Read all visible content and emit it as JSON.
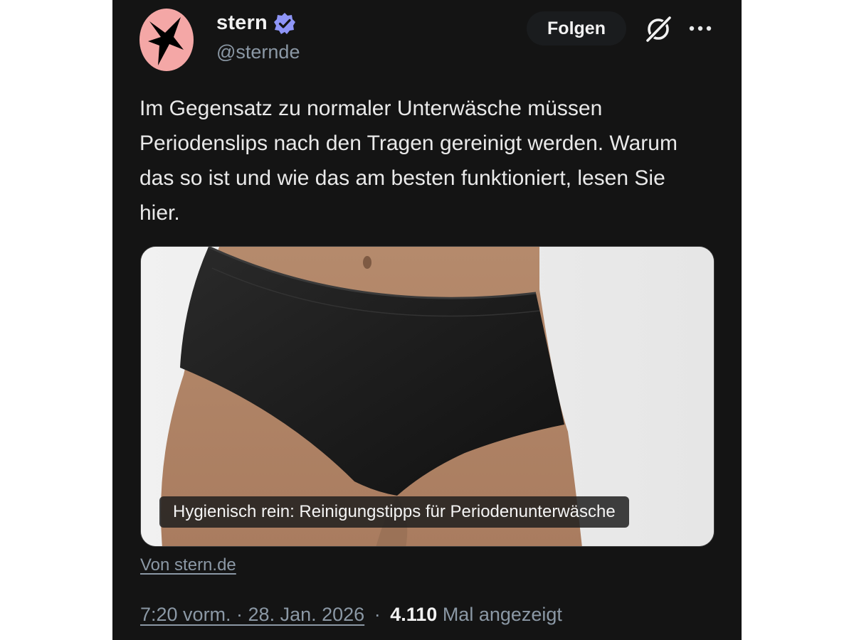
{
  "tweet": {
    "author_name": "stern",
    "handle": "@sternde",
    "follow_label": "Folgen",
    "text": "Im Gegensatz zu normaler Unterwäsche müssen Periodenslips nach den Tragen gereinigt werden. Warum das so ist und wie das am besten funktioniert, lesen Sie hier.",
    "card": {
      "title": "Hygienisch rein: Reinigungstipps für Periodenunterwäsche",
      "source": "Von stern.de"
    },
    "time": "7:20 vorm. · 28. Jan. 2026",
    "separator": "·",
    "views_count": "4.110",
    "views_label": "Mal angezeigt"
  },
  "icons": {
    "verified": "verified-badge-icon",
    "grok": "grok-icon",
    "more": "more-options-icon",
    "avatar": "stern-logo"
  },
  "colors": {
    "background": "#141414",
    "avatar_bg": "#f4a7a6",
    "verified_badge": "#8e95f7",
    "muted_text": "#8b98a5"
  }
}
